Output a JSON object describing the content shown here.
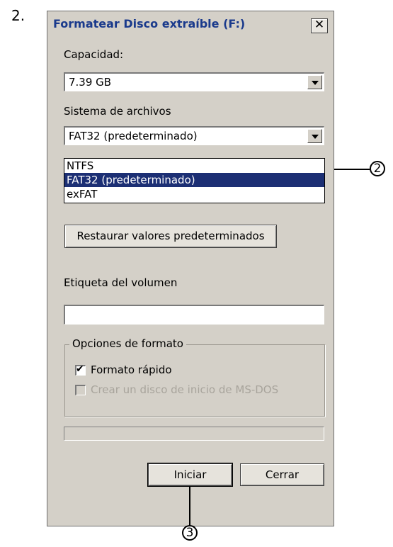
{
  "step_number": "2.",
  "dialog": {
    "title": "Formatear Disco extraíble (F:)",
    "close_glyph": "✕",
    "capacity": {
      "label": "Capacidad:",
      "value": "7.39 GB"
    },
    "filesystem": {
      "label": "Sistema de archivos",
      "value": "FAT32 (predeterminado)",
      "options": [
        {
          "label": "NTFS",
          "selected": false
        },
        {
          "label": "FAT32 (predeterminado)",
          "selected": true
        },
        {
          "label": "exFAT",
          "selected": false
        }
      ]
    },
    "restore_button": "Restaurar valores predeterminados",
    "volume_label": {
      "label": "Etiqueta del volumen",
      "value": ""
    },
    "format_options": {
      "label": "Opciones de formato",
      "quick_format": {
        "label": "Formato rápido",
        "checked": true,
        "check_glyph": "✔"
      },
      "msdos": {
        "label": "Crear un disco de inicio de MS-DOS",
        "checked": false
      }
    },
    "start_button": "Iniciar",
    "close_button": "Cerrar"
  },
  "callouts": {
    "two": "2",
    "three": "3"
  }
}
